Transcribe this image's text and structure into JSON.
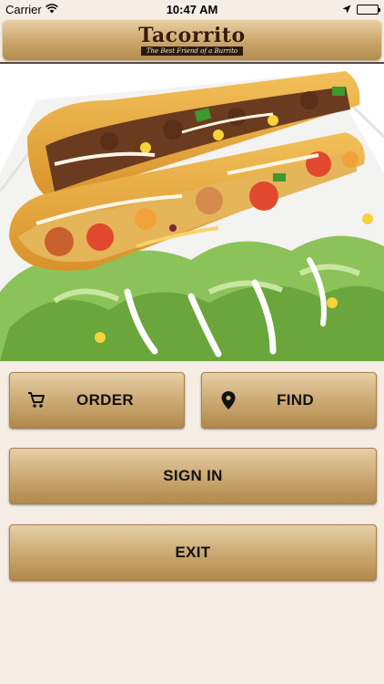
{
  "status_bar": {
    "carrier": "Carrier",
    "time": "10:47 AM"
  },
  "header": {
    "logo_text": "Tacorrito",
    "logo_tagline": "The Best Friend of a Burrito"
  },
  "hero": {
    "image_description_icon": "tacos-salad-photo"
  },
  "buttons": {
    "order": "ORDER",
    "find": "FIND",
    "sign_in": "SIGN IN",
    "exit": "EXIT"
  },
  "icons": {
    "order": "cart-icon",
    "find": "location-pin-icon"
  },
  "colors": {
    "background": "#f6ede4",
    "button_top": "#e6cfa8",
    "button_bottom": "#b2884c",
    "logo_text": "#3a1a0a"
  }
}
